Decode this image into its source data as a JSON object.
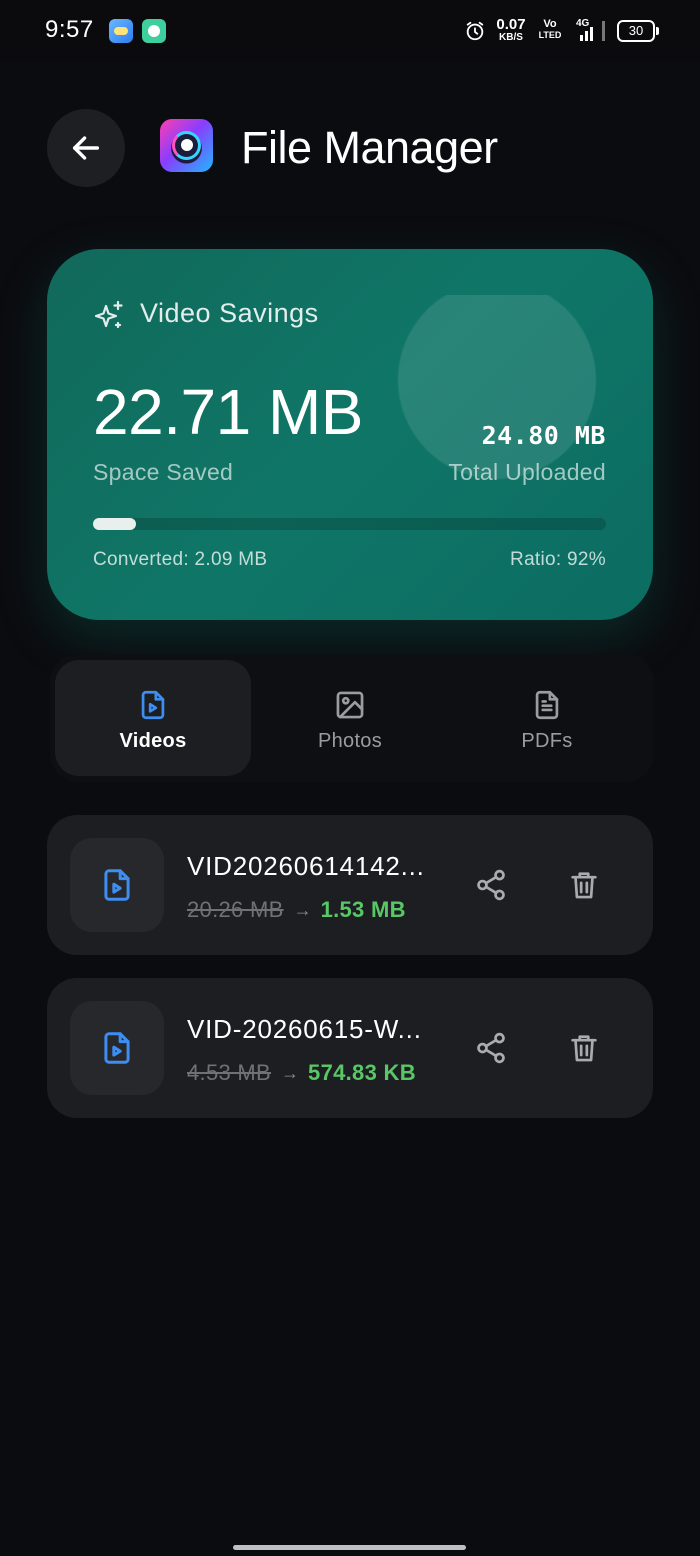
{
  "status_bar": {
    "time": "9:57",
    "net_speed_value": "0.07",
    "net_speed_unit": "KB/S",
    "volte_top": "Vo",
    "volte_bottom": "LTED",
    "network": "4G",
    "battery": "30",
    "icons": [
      "weather-app-icon",
      "chat-app-icon",
      "alarm-icon",
      "signal-icon",
      "battery-icon"
    ]
  },
  "header": {
    "title": "File Manager",
    "back_icon": "arrow-left-icon",
    "logo_icon": "file-manager-logo"
  },
  "savings": {
    "title": "Video Savings",
    "space_saved_value": "22.71 MB",
    "space_saved_label": "Space Saved",
    "total_uploaded_value": "24.80 MB",
    "total_uploaded_label": "Total Uploaded",
    "converted_text": "Converted: 2.09 MB",
    "ratio_text": "Ratio: 92%",
    "progress_fraction": 0.084,
    "colors": {
      "card_start": "#11695a",
      "card_end": "#0c6c62"
    }
  },
  "tabs": [
    {
      "label": "Videos",
      "icon": "video-file-icon",
      "active": true
    },
    {
      "label": "Photos",
      "icon": "image-icon",
      "active": false
    },
    {
      "label": "PDFs",
      "icon": "document-icon",
      "active": false
    }
  ],
  "files": [
    {
      "name": "VID20260614142...",
      "original_size": "20.26 MB",
      "new_size": "1.53 MB"
    },
    {
      "name": "VID-20260615-W...",
      "original_size": "4.53 MB",
      "new_size": "574.83 KB"
    }
  ],
  "colors": {
    "background": "#0b0c10",
    "accent_blue": "#3d8ef0",
    "success_green": "#58c766",
    "surface": "#1d1e21"
  }
}
